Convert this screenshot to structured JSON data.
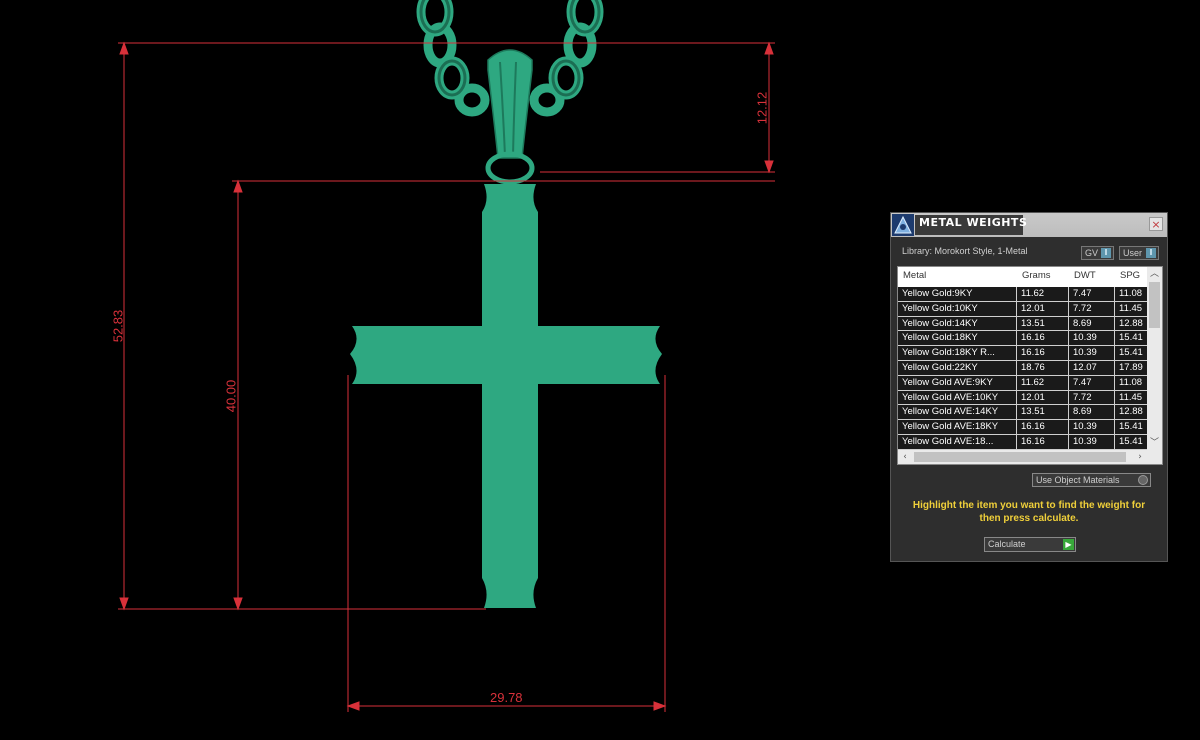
{
  "dimensions": {
    "overall_height": "52.83",
    "bail_height": "12.12",
    "cross_height": "40.00",
    "cross_width": "29.78"
  },
  "colors": {
    "model": "#2ea881",
    "dimension_lines": "#d8313a",
    "hint_text": "#f0d03a"
  },
  "panel": {
    "title": "METAL WEIGHTS",
    "close_label": "×",
    "library": "Library: Morokort Style, 1-Metal",
    "gv_label": "GV",
    "user_label": "User",
    "columns": [
      "Metal",
      "Grams",
      "DWT",
      "SPG"
    ],
    "rows": [
      [
        "Yellow Gold:9KY",
        "11.62",
        "7.47",
        "11.08"
      ],
      [
        "Yellow Gold:10KY",
        "12.01",
        "7.72",
        "11.45"
      ],
      [
        "Yellow Gold:14KY",
        "13.51",
        "8.69",
        "12.88"
      ],
      [
        "Yellow Gold:18KY",
        "16.16",
        "10.39",
        "15.41"
      ],
      [
        "Yellow Gold:18KY R...",
        "16.16",
        "10.39",
        "15.41"
      ],
      [
        "Yellow Gold:22KY",
        "18.76",
        "12.07",
        "17.89"
      ],
      [
        "Yellow Gold AVE:9KY",
        "11.62",
        "7.47",
        "11.08"
      ],
      [
        "Yellow Gold AVE:10KY",
        "12.01",
        "7.72",
        "11.45"
      ],
      [
        "Yellow Gold AVE:14KY",
        "13.51",
        "8.69",
        "12.88"
      ],
      [
        "Yellow Gold AVE:18KY",
        "16.16",
        "10.39",
        "15.41"
      ],
      [
        "Yellow Gold AVE:18...",
        "16.16",
        "10.39",
        "15.41"
      ]
    ],
    "materials_label": "Use Object Materials",
    "hint": "Highlight the item you want to find the weight for then press calculate.",
    "calculate_label": "Calculate"
  }
}
